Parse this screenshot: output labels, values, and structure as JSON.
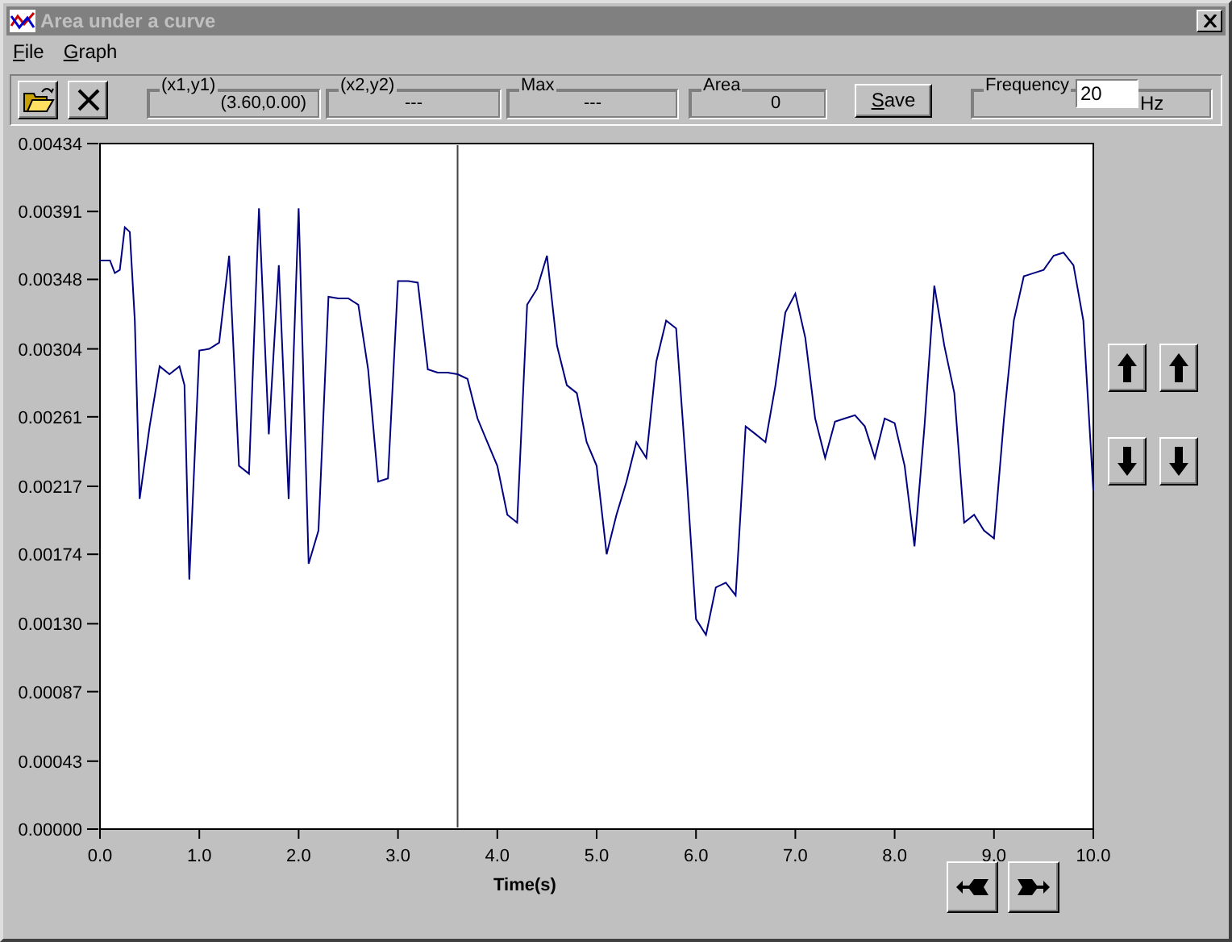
{
  "window": {
    "title": "Area under a curve"
  },
  "menu": [
    {
      "label": "File"
    },
    {
      "label": "Graph"
    }
  ],
  "toolbar": {
    "fields": [
      {
        "label": "(x1,y1)",
        "value": "(3.60,0.00)"
      },
      {
        "label": "(x2,y2)",
        "value": "---"
      },
      {
        "label": "Max",
        "value": "---"
      },
      {
        "label": "Area",
        "value": "0"
      }
    ],
    "save_button": "Save",
    "frequency": {
      "label": "Frequency",
      "value": "20",
      "unit": "Hz"
    }
  },
  "chart_data": {
    "type": "line",
    "xlabel": "Time(s)",
    "xlim": [
      0,
      10
    ],
    "ylim": [
      0,
      0.00434
    ],
    "xticks": [
      {
        "value": 0,
        "label": "0.0"
      },
      {
        "value": 1,
        "label": "1.0"
      },
      {
        "value": 2,
        "label": "2.0"
      },
      {
        "value": 3,
        "label": "3.0"
      },
      {
        "value": 4,
        "label": "4.0"
      },
      {
        "value": 5,
        "label": "5.0"
      },
      {
        "value": 6,
        "label": "6.0"
      },
      {
        "value": 7,
        "label": "7.0"
      },
      {
        "value": 8,
        "label": "8.0"
      },
      {
        "value": 9,
        "label": "9.0"
      },
      {
        "value": 10,
        "label": "10.0"
      }
    ],
    "yticks": [
      {
        "value": 0,
        "label": "0.00000"
      },
      {
        "value": 0.00043,
        "label": "0.00043"
      },
      {
        "value": 0.00087,
        "label": "0.00087"
      },
      {
        "value": 0.0013,
        "label": "0.00130"
      },
      {
        "value": 0.00174,
        "label": "0.00174"
      },
      {
        "value": 0.00217,
        "label": "0.00217"
      },
      {
        "value": 0.00261,
        "label": "0.00261"
      },
      {
        "value": 0.00304,
        "label": "0.00304"
      },
      {
        "value": 0.00348,
        "label": "0.00348"
      },
      {
        "value": 0.00391,
        "label": "0.00391"
      },
      {
        "value": 0.00434,
        "label": "0.00434"
      }
    ],
    "x": [
      0,
      0.1,
      0.15,
      0.2,
      0.25,
      0.3,
      0.35,
      0.4,
      0.5,
      0.6,
      0.7,
      0.8,
      0.85,
      0.9,
      1.0,
      1.1,
      1.2,
      1.3,
      1.4,
      1.5,
      1.6,
      1.7,
      1.8,
      1.9,
      2.0,
      2.1,
      2.2,
      2.3,
      2.4,
      2.5,
      2.6,
      2.7,
      2.8,
      2.9,
      3.0,
      3.1,
      3.2,
      3.3,
      3.4,
      3.5,
      3.6,
      3.7,
      3.8,
      3.9,
      4.0,
      4.1,
      4.2,
      4.3,
      4.4,
      4.5,
      4.6,
      4.7,
      4.8,
      4.9,
      5.0,
      5.1,
      5.2,
      5.3,
      5.4,
      5.5,
      5.6,
      5.7,
      5.8,
      5.9,
      6.0,
      6.1,
      6.2,
      6.3,
      6.4,
      6.5,
      6.6,
      6.7,
      6.8,
      6.9,
      7.0,
      7.1,
      7.2,
      7.3,
      7.4,
      7.5,
      7.6,
      7.7,
      7.8,
      7.9,
      8.0,
      8.1,
      8.2,
      8.3,
      8.4,
      8.5,
      8.6,
      8.7,
      8.8,
      8.9,
      9.0,
      9.1,
      9.2,
      9.3,
      9.4,
      9.5,
      9.6,
      9.7,
      9.8,
      9.9,
      10.0
    ],
    "series": [
      {
        "color": "#000080",
        "values": [
          0.0036,
          0.0036,
          0.00352,
          0.00354,
          0.00381,
          0.00378,
          0.00322,
          0.00209,
          0.00255,
          0.00293,
          0.00288,
          0.00293,
          0.00281,
          0.00158,
          0.00303,
          0.00304,
          0.00308,
          0.00363,
          0.0023,
          0.00225,
          0.00393,
          0.0025,
          0.00357,
          0.00209,
          0.00393,
          0.00168,
          0.00189,
          0.00337,
          0.00336,
          0.00336,
          0.00332,
          0.00291,
          0.0022,
          0.00222,
          0.00347,
          0.00347,
          0.00346,
          0.00291,
          0.00289,
          0.00289,
          0.00288,
          0.00285,
          0.0026,
          0.00245,
          0.0023,
          0.00199,
          0.00194,
          0.00332,
          0.00342,
          0.00363,
          0.00306,
          0.00281,
          0.00276,
          0.00245,
          0.0023,
          0.00174,
          0.00199,
          0.0022,
          0.00245,
          0.00235,
          0.00296,
          0.00322,
          0.00317,
          0.0023,
          0.00133,
          0.00123,
          0.00153,
          0.00156,
          0.00148,
          0.00255,
          0.0025,
          0.00245,
          0.00281,
          0.00327,
          0.00339,
          0.00311,
          0.0026,
          0.00235,
          0.00258,
          0.0026,
          0.00262,
          0.00255,
          0.00235,
          0.0026,
          0.00257,
          0.0023,
          0.00179,
          0.00255,
          0.00344,
          0.00306,
          0.00276,
          0.00194,
          0.00199,
          0.00189,
          0.00184,
          0.0026,
          0.00322,
          0.0035,
          0.00352,
          0.00354,
          0.00363,
          0.00365,
          0.00357,
          0.00322,
          0.00214
        ]
      }
    ],
    "ref_lines": [
      {
        "axis": "x",
        "value": 3.6
      }
    ]
  }
}
